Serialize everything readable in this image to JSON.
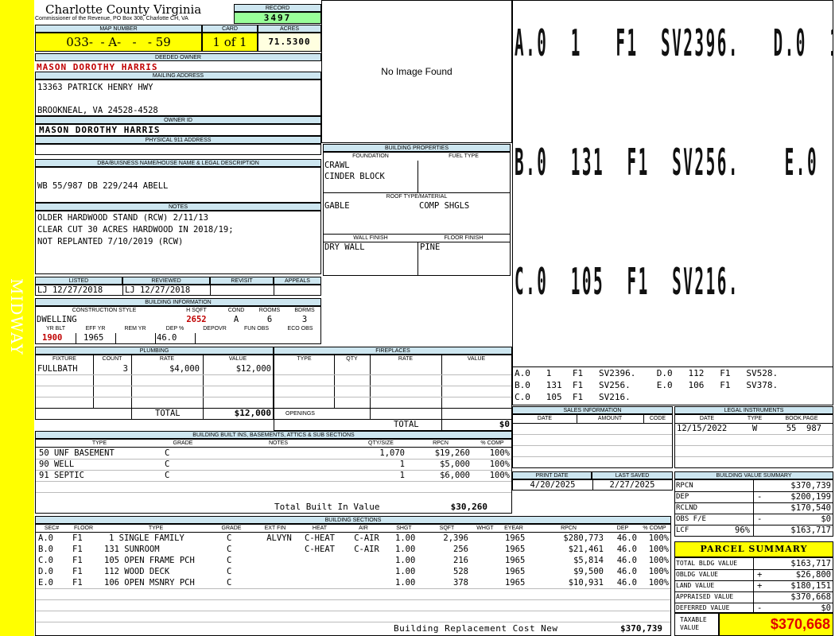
{
  "sidebar": {
    "label": "MIDWAY"
  },
  "header": {
    "county": "Charlotte County Virginia",
    "address": "Commissioner of the Revenue, PO Box 308, Charlotte CH, VA"
  },
  "record": {
    "label": "RECORD",
    "value": "3497"
  },
  "map": {
    "label": "MAP NUMBER",
    "value": "033-  - A-   -   - 59",
    "card_label": "CARD",
    "card_value": "1 of 1",
    "acres_label": "ACRES",
    "acres_value": "71.5300"
  },
  "owner": {
    "deeded_label": "DEEDED OWNER",
    "deeded_value": "MASON DOROTHY HARRIS",
    "mailing_label": "MAILING ADDRESS",
    "mailing_line1": "13363 PATRICK HENRY HWY",
    "mailing_line2": "BROOKNEAL, VA 24528-4528",
    "owner_id_label": "OWNER ID",
    "owner_id_value": "MASON DOROTHY HARRIS",
    "physical_label": "PHYSICAL 911 ADDRESS",
    "physical_value": ""
  },
  "image": {
    "placeholder": "No Image Found"
  },
  "dba": {
    "label": "DBA/BUISNESS NAME/HOUSE NAME & LEGAL DESCRIPTION",
    "value": "WB 55/987 DB 229/244 ABELL"
  },
  "notes": {
    "label": "NOTES",
    "lines": [
      "OLDER HARDWOOD STAND (RCW) 2/11/13",
      "CLEAR CUT 30 ACRES HARDWOOD IN 2018/19;",
      "NOT REPLANTED 7/10/2019 (RCW)"
    ]
  },
  "status": {
    "listed_label": "LISTED",
    "listed_value": "LJ   12/27/2018",
    "reviewed_label": "REVIEWED",
    "reviewed_value": "LJ   12/27/2018",
    "revisit_label": "REVISIT",
    "appeals_label": "APPEALS"
  },
  "building_info": {
    "label": "BUILDING INFORMATION",
    "cols": [
      "CONSTRUCTION STYLE",
      "H SQFT",
      "COND",
      "ROOMS",
      "BDRMS"
    ],
    "style": "DWELLING",
    "hsqft": "2652",
    "cond": "A",
    "rooms": "6",
    "bdrms": "3",
    "cols2": [
      "YR BLT",
      "EFF YR",
      "REM YR",
      "DEP %",
      "DEPOVR",
      "FUN OBS",
      "ECO OBS"
    ],
    "yrblt": "1900",
    "effyr": "1965",
    "remyr": "",
    "dep": "46.0"
  },
  "plumbing": {
    "label": "PLUMBING",
    "cols": [
      "FIXTURE",
      "COUNT",
      "RATE",
      "VALUE"
    ],
    "rows": [
      {
        "fixture": "FULLBATH",
        "count": "3",
        "rate": "$4,000",
        "value": "$12,000"
      }
    ],
    "total_label": "TOTAL",
    "total_value": "$12,000"
  },
  "fireplaces": {
    "label": "FIREPLACES",
    "cols": [
      "TYPE",
      "QTY",
      "RATE",
      "VALUE"
    ],
    "openings_label": "OPENINGS",
    "total_label": "TOTAL",
    "total_value": "$0"
  },
  "building_props": {
    "label": "BUILDING PROPERTIES",
    "foundation_label": "FOUNDATION",
    "fuel_label": "FUEL TYPE",
    "foundation_values": [
      "CRAWL",
      "CINDER BLOCK"
    ],
    "roof_label": "ROOF TYPE/MATERIAL",
    "roof_type": "GABLE",
    "roof_material": "COMP SHGLS",
    "wall_label": "WALL FINISH",
    "wall_value": "DRY WALL",
    "floor_label": "FLOOR FINISH",
    "floor_value": "PINE"
  },
  "sketch": {
    "big_lines": [
      "A.0  1   F1  SV2396.   D.0  112  F1  SV528.",
      "B.0  131  F1  SV256.    E.0  106  F1  SV378.",
      "C.0  105  F1  SV216."
    ],
    "legend_lines": [
      "A.0   1    F1   SV2396.    D.0   112   F1   SV528.",
      "B.0   131  F1   SV256.     E.0   106   F1   SV378.",
      "C.0   105  F1   SV216."
    ]
  },
  "builtins": {
    "label": "BUILDING BUILT INS, BASEMENTS, ATTICS & SUB SECTIONS",
    "cols": [
      "TYPE",
      "GRADE",
      "NOTES",
      "QTY/SIZE",
      "RPCN",
      "% COMP"
    ],
    "rows": [
      {
        "type": "50 UNF BASEMENT",
        "grade": "C",
        "qty": "1,070",
        "rpcn": "$19,260",
        "comp": "100%"
      },
      {
        "type": "90 WELL",
        "grade": "C",
        "qty": "1",
        "rpcn": "$5,000",
        "comp": "100%"
      },
      {
        "type": "91 SEPTIC",
        "grade": "C",
        "qty": "1",
        "rpcn": "$6,000",
        "comp": "100%"
      }
    ],
    "total_label": "Total Built In Value",
    "total_value": "$30,260"
  },
  "sales": {
    "label": "SALES INFORMATION",
    "cols": [
      "DATE",
      "AMOUNT",
      "CODE"
    ]
  },
  "legal": {
    "label": "LEGAL INSTRUMENTS",
    "cols": [
      "DATE",
      "TYPE",
      "BOOK.PAGE"
    ],
    "rows": [
      {
        "date": "12/15/2022",
        "type": "W",
        "book": "55  987"
      }
    ]
  },
  "print": {
    "print_label": "PRINT DATE",
    "print_value": "4/20/2025",
    "saved_label": "LAST SAVED",
    "saved_value": "2/27/2025"
  },
  "sections": {
    "label": "BUILDING SECTIONS",
    "cols": [
      "SEC#",
      "FLOOR",
      "TYPE",
      "GRADE",
      "EXT FIN",
      "HEAT",
      "AIR",
      "SHGT",
      "SQFT",
      "WHGT",
      "EYEAR",
      "RPCN",
      "DEP",
      "% COMP"
    ],
    "rows": [
      {
        "sec": "A.0",
        "floor": "F1",
        "type": "1 SINGLE FAMILY",
        "grade": "C",
        "ext": "ALVYN",
        "heat": "C-HEAT",
        "air": "C-AIR",
        "shgt": "1.00",
        "sqft": "2,396",
        "eyear": "1965",
        "rpcn": "$280,773",
        "dep": "46.0",
        "comp": "100%"
      },
      {
        "sec": "B.0",
        "floor": "F1",
        "type": "131 SUNROOM",
        "grade": "C",
        "ext": "",
        "heat": "C-HEAT",
        "air": "C-AIR",
        "shgt": "1.00",
        "sqft": "256",
        "eyear": "1965",
        "rpcn": "$21,461",
        "dep": "46.0",
        "comp": "100%"
      },
      {
        "sec": "C.0",
        "floor": "F1",
        "type": "105 OPEN FRAME PCH",
        "grade": "C",
        "ext": "",
        "heat": "",
        "air": "",
        "shgt": "1.00",
        "sqft": "216",
        "eyear": "1965",
        "rpcn": "$5,814",
        "dep": "46.0",
        "comp": "100%"
      },
      {
        "sec": "D.0",
        "floor": "F1",
        "type": "112 WOOD DECK",
        "grade": "C",
        "ext": "",
        "heat": "",
        "air": "",
        "shgt": "1.00",
        "sqft": "528",
        "eyear": "1965",
        "rpcn": "$9,500",
        "dep": "46.0",
        "comp": "100%"
      },
      {
        "sec": "E.0",
        "floor": "F1",
        "type": "106 OPEN MSNRY PCH",
        "grade": "C",
        "ext": "",
        "heat": "",
        "air": "",
        "shgt": "1.00",
        "sqft": "378",
        "eyear": "1965",
        "rpcn": "$10,931",
        "dep": "46.0",
        "comp": "100%"
      }
    ],
    "total_label": "Building Replacement Cost New",
    "total_value": "$370,739"
  },
  "value_summary": {
    "label": "BUILDING VALUE SUMMARY",
    "rows": [
      {
        "label": "RPCN",
        "sign": "",
        "value": "$370,739"
      },
      {
        "label": "DEP",
        "sign": "-",
        "value": "$200,199"
      },
      {
        "label": "RCLND",
        "sign": "",
        "value": "$170,540"
      },
      {
        "label": "OBS F/E",
        "sign": "-",
        "value": "$0"
      },
      {
        "label": "LCF",
        "pct": "96%",
        "sign": "",
        "value": "$163,717"
      }
    ]
  },
  "parcel": {
    "label": "PARCEL SUMMARY",
    "rows": [
      {
        "label": "TOTAL BLDG VALUE",
        "sign": "",
        "value": "$163,717"
      },
      {
        "label": "OBLDG VALUE",
        "sign": "+",
        "value": "$26,800"
      },
      {
        "label": "LAND VALUE",
        "sign": "+",
        "value": "$180,151"
      },
      {
        "label": "APPRAISED VALUE",
        "sign": "",
        "value": "$370,668"
      },
      {
        "label": "DEFERRED VALUE",
        "sign": "-",
        "value": "$0"
      }
    ],
    "taxable_label": "TAXABLE VALUE",
    "taxable_value": "$370,668"
  }
}
